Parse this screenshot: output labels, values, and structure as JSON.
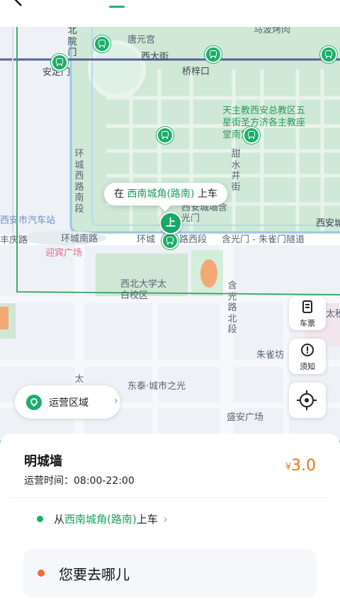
{
  "map": {
    "labels": {
      "beiyuanmen": "北院门",
      "tangyuangong": "唐元宫",
      "mabo": "马波烤肉",
      "xidajie": "西大街",
      "anding": "安定门",
      "qiaozikou": "桥梓口",
      "church": "天主教西安总教区五星街圣方济各主教座堂南堂",
      "ring_west": "环城西路南段",
      "tian_shui": "甜水井街",
      "qiche": "西安市汽车站",
      "fengqing": "丰庆路",
      "ring_south": "环城南路",
      "yingbin": "迎宾广场",
      "huancheng2": "环城",
      "lu_xi_duan": "路西段",
      "hanguang_tunnel": "含光门 - 朱雀门隧道",
      "city_wall": "西安城墙含光门",
      "xian_right": "西安城",
      "northwest_univ": "西北大学太白校区",
      "hanguang_north": "含光路北段",
      "zhuquefang": "朱雀坊",
      "taishui": "太税",
      "tai_lu": "太路",
      "dongtai": "东泰·城市之光",
      "shengan": "盛安广场",
      "right_cut": "西安城墙"
    },
    "pickup_pin_label": "上",
    "bubble": {
      "prefix": "在",
      "station": "西南城角(路南)",
      "suffix": "上车"
    }
  },
  "controls": {
    "ticket_label": "车票",
    "notice_label": "须知",
    "operating_area_label": "运营区域",
    "chevron": "›"
  },
  "route": {
    "name": "明城墙",
    "hours": "运营时间：08:00-22:00",
    "currency": "¥",
    "price": "3.0"
  },
  "pickup": {
    "prefix": "从",
    "station": "西南城角(路南)",
    "suffix": "上车",
    "chevron": "›"
  },
  "destination": {
    "placeholder": "您要去哪儿"
  },
  "colors": {
    "accent_green": "#1a9e5f",
    "price_orange": "#f07316",
    "destination_dot": "#f36a37"
  }
}
